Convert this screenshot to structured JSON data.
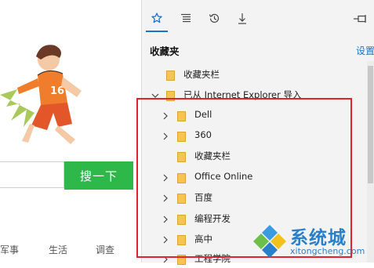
{
  "left_page": {
    "search_button_label": "搜一下",
    "nav_links": [
      "军事",
      "生活",
      "调查"
    ],
    "brand_green": "#2fb84a"
  },
  "panel": {
    "tabs": [
      {
        "name": "favorites",
        "icon": "star-icon",
        "active": true
      },
      {
        "name": "reading-list",
        "icon": "reading-list-icon",
        "active": false
      },
      {
        "name": "history",
        "icon": "history-icon",
        "active": false
      },
      {
        "name": "downloads",
        "icon": "download-icon",
        "active": false
      }
    ],
    "pin_icon": "pin-icon",
    "title": "收藏夹",
    "settings_label": "设置",
    "accent": "#1a73c9",
    "items": [
      {
        "label": "收藏夹栏",
        "expandable": false
      },
      {
        "label": "已从 Internet Explorer 导入",
        "expandable": true,
        "expanded": true
      },
      {
        "label": "Dell",
        "expandable": true
      },
      {
        "label": "360",
        "expandable": true
      },
      {
        "label": "收藏夹栏",
        "expandable": false
      },
      {
        "label": "Office Online",
        "expandable": true
      },
      {
        "label": "百度",
        "expandable": true
      },
      {
        "label": "编程开发",
        "expandable": true
      },
      {
        "label": "高中",
        "expandable": true
      },
      {
        "label": "工程学院",
        "expandable": true
      }
    ],
    "folder_color": "#f5c451"
  },
  "highlight_color": "#e0242c",
  "watermark": {
    "text": "系统城",
    "url": "xitongcheng.com"
  }
}
